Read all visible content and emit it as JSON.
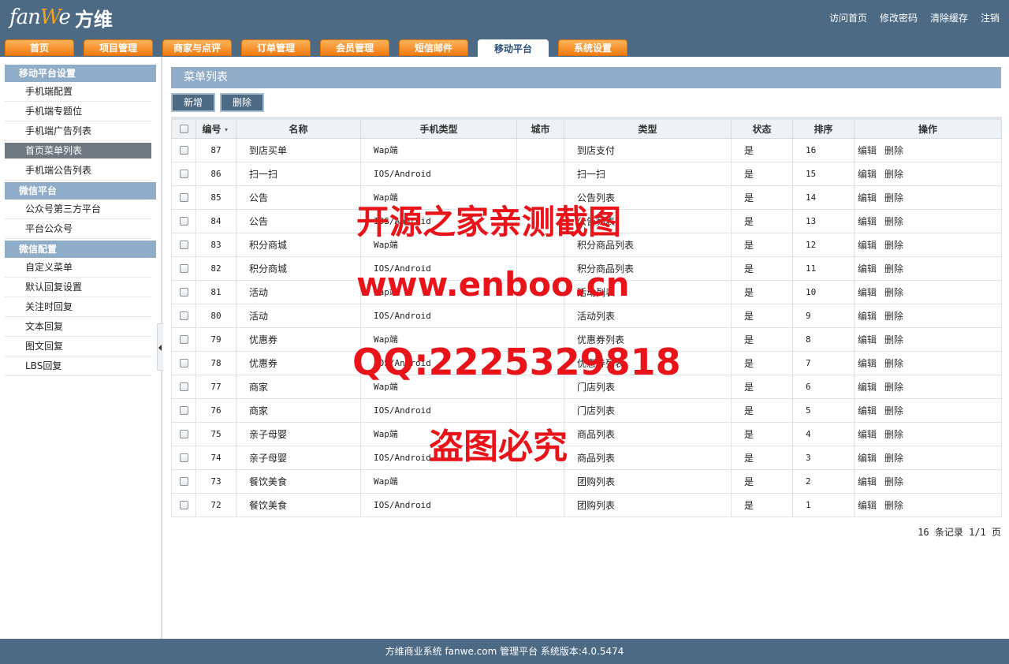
{
  "header": {
    "brand_fan": "fan",
    "brand_e": "W",
    "brand_we": "e",
    "brand_cn": "方维",
    "top_links": [
      "访问首页",
      "修改密码",
      "清除缓存",
      "注销"
    ]
  },
  "nav": {
    "tabs": [
      "首页",
      "项目管理",
      "商家与点评",
      "订单管理",
      "会员管理",
      "短信邮件",
      "移动平台",
      "系统设置"
    ],
    "active_index": 6
  },
  "sidebar": {
    "groups": [
      {
        "title": "移动平台设置",
        "items": [
          "手机端配置",
          "手机端专题位",
          "手机端广告列表",
          "首页菜单列表",
          "手机端公告列表"
        ]
      },
      {
        "title": "微信平台",
        "items": [
          "公众号第三方平台",
          "平台公众号"
        ]
      },
      {
        "title": "微信配置",
        "items": [
          "自定义菜单",
          "默认回复设置",
          "关注时回复",
          "文本回复",
          "图文回复",
          "LBS回复"
        ]
      }
    ],
    "active_item": "首页菜单列表"
  },
  "main": {
    "title": "菜单列表",
    "buttons": {
      "add": "新增",
      "delete": "删除"
    },
    "columns": [
      "编号",
      "名称",
      "手机类型",
      "城市",
      "类型",
      "状态",
      "排序",
      "操作"
    ],
    "rows": [
      {
        "id": "87",
        "name": "到店买单",
        "mobile": "Wap端",
        "city": "",
        "type": "到店支付",
        "status": "是",
        "sort": "16"
      },
      {
        "id": "86",
        "name": "扫一扫",
        "mobile": "IOS/Android",
        "city": "",
        "type": "扫一扫",
        "status": "是",
        "sort": "15"
      },
      {
        "id": "85",
        "name": "公告",
        "mobile": "Wap端",
        "city": "",
        "type": "公告列表",
        "status": "是",
        "sort": "14"
      },
      {
        "id": "84",
        "name": "公告",
        "mobile": "IOS/Android",
        "city": "",
        "type": "公告列表",
        "status": "是",
        "sort": "13"
      },
      {
        "id": "83",
        "name": "积分商城",
        "mobile": "Wap端",
        "city": "",
        "type": "积分商品列表",
        "status": "是",
        "sort": "12"
      },
      {
        "id": "82",
        "name": "积分商城",
        "mobile": "IOS/Android",
        "city": "",
        "type": "积分商品列表",
        "status": "是",
        "sort": "11"
      },
      {
        "id": "81",
        "name": "活动",
        "mobile": "Wap端",
        "city": "",
        "type": "活动列表",
        "status": "是",
        "sort": "10"
      },
      {
        "id": "80",
        "name": "活动",
        "mobile": "IOS/Android",
        "city": "",
        "type": "活动列表",
        "status": "是",
        "sort": "9"
      },
      {
        "id": "79",
        "name": "优惠券",
        "mobile": "Wap端",
        "city": "",
        "type": "优惠券列表",
        "status": "是",
        "sort": "8"
      },
      {
        "id": "78",
        "name": "优惠券",
        "mobile": "IOS/Android",
        "city": "",
        "type": "优惠券列表",
        "status": "是",
        "sort": "7"
      },
      {
        "id": "77",
        "name": "商家",
        "mobile": "Wap端",
        "city": "",
        "type": "门店列表",
        "status": "是",
        "sort": "6"
      },
      {
        "id": "76",
        "name": "商家",
        "mobile": "IOS/Android",
        "city": "",
        "type": "门店列表",
        "status": "是",
        "sort": "5"
      },
      {
        "id": "75",
        "name": "亲子母婴",
        "mobile": "Wap端",
        "city": "",
        "type": "商品列表",
        "status": "是",
        "sort": "4"
      },
      {
        "id": "74",
        "name": "亲子母婴",
        "mobile": "IOS/Android",
        "city": "",
        "type": "商品列表",
        "status": "是",
        "sort": "3"
      },
      {
        "id": "73",
        "name": "餐饮美食",
        "mobile": "Wap端",
        "city": "",
        "type": "团购列表",
        "status": "是",
        "sort": "2"
      },
      {
        "id": "72",
        "name": "餐饮美食",
        "mobile": "IOS/Android",
        "city": "",
        "type": "团购列表",
        "status": "是",
        "sort": "1"
      }
    ],
    "row_actions": {
      "edit": "编辑",
      "delete": "删除"
    },
    "pager": "16 条记录 1/1 页"
  },
  "watermark": {
    "line1": "开源之家亲测截图",
    "line2": "www.enboo.cn",
    "line3": "QQ:2225329818",
    "line4": "盗图必究"
  },
  "footer": {
    "text": "方维商业系统 fanwe.com 管理平台 系统版本:4.0.5474"
  },
  "colors": {
    "header_bg": "#4d6a85",
    "nav_tab": "#f58a1f",
    "section_bg": "#8facc8",
    "active_item_bg": "#6f7880",
    "watermark": "#e8141a"
  }
}
